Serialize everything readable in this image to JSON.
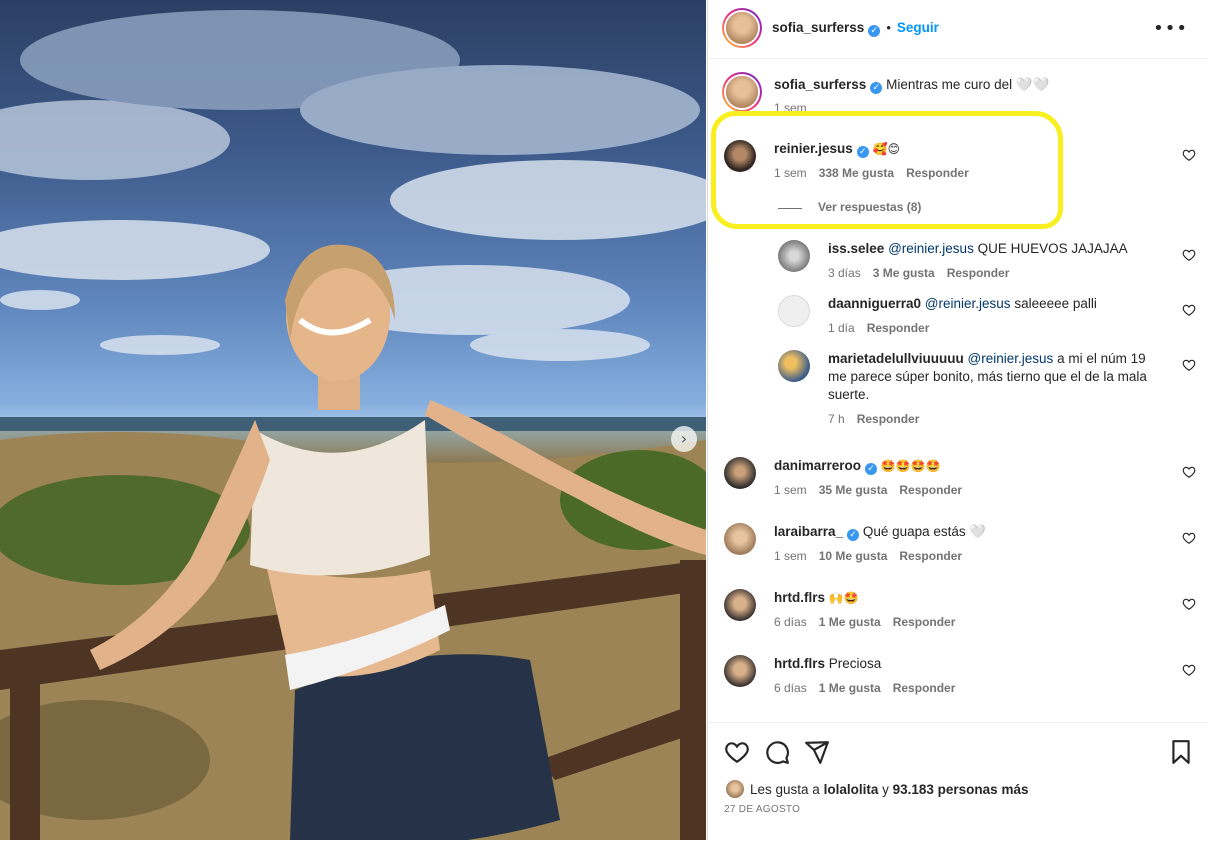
{
  "post": {
    "author": "sofia_surferss",
    "follow_label": "Seguir",
    "dot": "•",
    "more_label": "•••",
    "next_label": "›"
  },
  "caption": {
    "username": "sofia_surferss",
    "text": "Mientras me curo del 🤍🤍",
    "time": "1 sem"
  },
  "comments": [
    {
      "username": "reinier.jesus",
      "verified": true,
      "text": "🥰😊",
      "time": "1 sem",
      "likes": "338 Me gusta",
      "reply": "Responder",
      "view_replies": "Ver respuestas (8)"
    },
    {
      "username": "iss.selee",
      "mention": "@reinier.jesus",
      "text": "QUE HUEVOS JAJAJAA",
      "time": "3 días",
      "likes": "3 Me gusta",
      "reply": "Responder"
    },
    {
      "username": "daanniguerra0",
      "mention": "@reinier.jesus",
      "text": "saleeeee palli",
      "time": "1 día",
      "reply": "Responder"
    },
    {
      "username": "marietadelullviuuuuu",
      "mention": "@reinier.jesus",
      "text": "a mi el núm 19",
      "text2": "me parece súper bonito, más tierno que el de la mala",
      "text3": "suerte.",
      "time": "7 h",
      "reply": "Responder"
    },
    {
      "username": "danimarreroo",
      "verified": true,
      "text": "🤩🤩🤩🤩",
      "time": "1 sem",
      "likes": "35 Me gusta",
      "reply": "Responder"
    },
    {
      "username": "laraibarra_",
      "verified": true,
      "text": "Qué guapa estás 🤍",
      "time": "1 sem",
      "likes": "10 Me gusta",
      "reply": "Responder"
    },
    {
      "username": "hrtd.flrs",
      "text": "🙌🤩",
      "time": "6 días",
      "likes": "1 Me gusta",
      "reply": "Responder"
    },
    {
      "username": "hrtd.flrs",
      "text": "Preciosa",
      "time": "6 días",
      "likes": "1 Me gusta",
      "reply": "Responder"
    }
  ],
  "footer": {
    "likes_prefix": "Les gusta a",
    "likes_user": "lolalolita",
    "likes_mid": "y",
    "likes_count": "93.183 personas más",
    "date": "27 de agosto"
  },
  "colors": {
    "accent": "#0095f6",
    "verified": "#3897f0",
    "highlight": "#f7ef1f",
    "muted": "#737373"
  },
  "icons": [
    "more-icon",
    "verified-icon",
    "heart-icon",
    "comment-icon",
    "share-icon",
    "save-icon",
    "next-arrow-icon"
  ]
}
